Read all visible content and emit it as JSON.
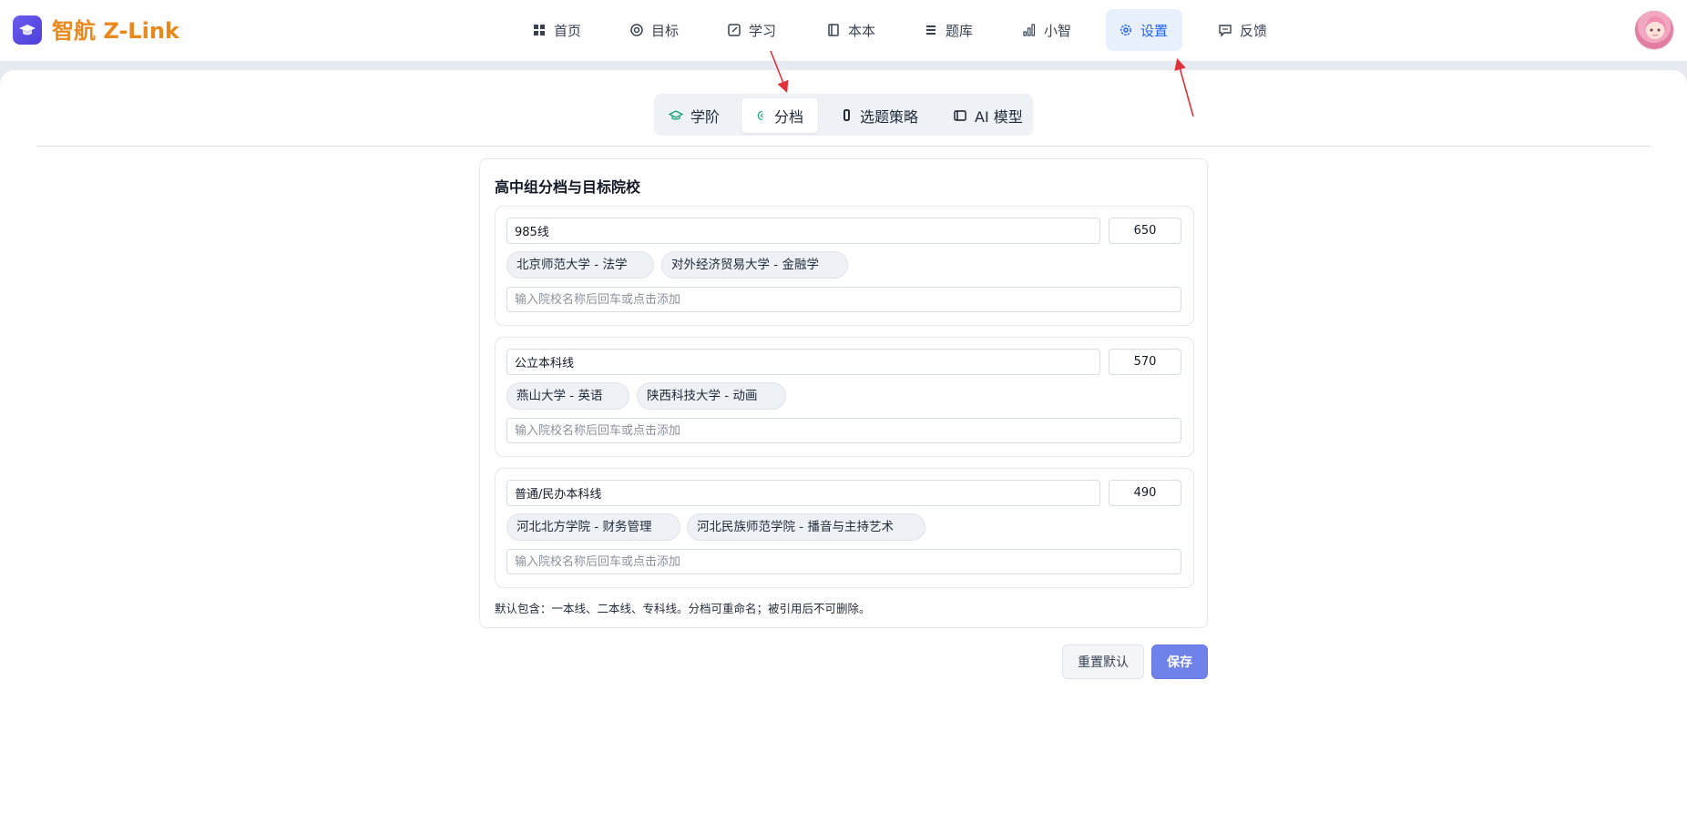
{
  "brand": {
    "name": "智航 Z-Link"
  },
  "nav": [
    {
      "label": "首页",
      "icon": "grid-icon"
    },
    {
      "label": "目标",
      "icon": "target-icon"
    },
    {
      "label": "学习",
      "icon": "edit-icon"
    },
    {
      "label": "本本",
      "icon": "book-icon"
    },
    {
      "label": "题库",
      "icon": "list-icon"
    },
    {
      "label": "小智",
      "icon": "bar-chart-icon"
    },
    {
      "label": "设置",
      "icon": "gear-icon",
      "active": true
    },
    {
      "label": "反馈",
      "icon": "message-icon"
    }
  ],
  "tabs": [
    {
      "label": "学阶",
      "icon": "graduation-cap-icon"
    },
    {
      "label": "分档",
      "icon": "tier-icon",
      "active": true
    },
    {
      "label": "选题策略",
      "icon": "strategy-icon"
    },
    {
      "label": "AI 模型",
      "icon": "model-icon"
    }
  ],
  "card": {
    "title": "高中组分档与目标院校",
    "tiers": [
      {
        "name": "985线",
        "score": "650",
        "schools": [
          "北京师范大学 - 法学",
          "对外经济贸易大学 - 金融学"
        ]
      },
      {
        "name": "公立本科线",
        "score": "570",
        "schools": [
          "燕山大学 - 英语",
          "陕西科技大学 - 动画"
        ]
      },
      {
        "name": "普通/民办本科线",
        "score": "490",
        "schools": [
          "河北北方学院 - 财务管理",
          "河北民族师范学院 - 播音与主持艺术"
        ]
      }
    ],
    "school_placeholder": "输入院校名称后回车或点击添加",
    "note": "默认包含：一本线、二本线、专科线。分档可重命名；被引用后不可删除。"
  },
  "actions": {
    "reset_label": "重置默认",
    "save_label": "保存"
  },
  "colors": {
    "brand": "#e8891e",
    "accent": "#2563eb",
    "save": "#6e82ea",
    "arrow": "#e0313b"
  }
}
